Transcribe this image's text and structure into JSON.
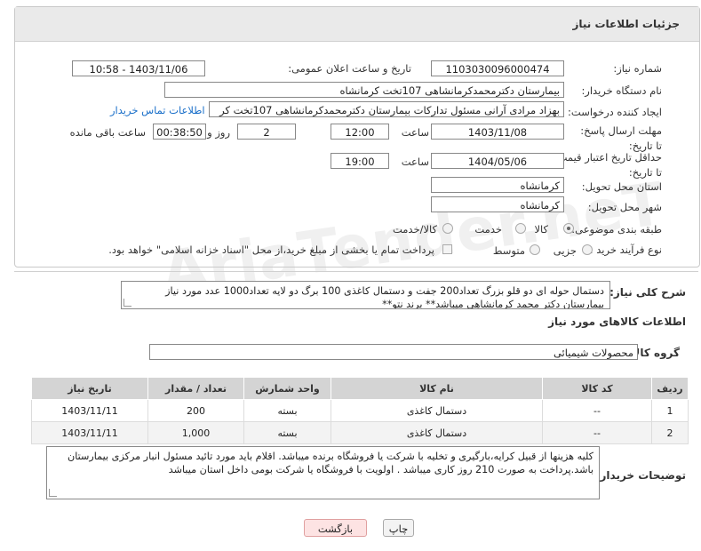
{
  "panel_title": "جزئیات اطلاعات نیاز",
  "fields": {
    "need_number_label": "شماره نیاز:",
    "need_number": "1103030096000474",
    "announce_label": "تاریخ و ساعت اعلان عمومی:",
    "announce_value": "1403/11/06 - 10:58",
    "buyer_org_label": "نام دستگاه خریدار:",
    "buyer_org": "بیمارستان دکترمحمدکرمانشاهی 107تخت کرمانشاه",
    "requester_label": "ایجاد کننده درخواست:",
    "requester": "بهزاد مرادی آرانی مسئول تدارکات بیمارستان دکترمحمدکرمانشاهی 107تخت کر",
    "contact_link": "اطلاعات تماس خریدار",
    "deadline_label": "مهلت ارسال پاسخ: تا تاریخ:",
    "deadline_date": "1403/11/08",
    "time_label": "ساعت",
    "deadline_time": "12:00",
    "days_value": "2",
    "days_label": "روز و",
    "remaining_value": "00:38:50",
    "remaining_label": "ساعت باقی مانده",
    "validity_label": "حداقل تاریخ اعتبار قیمت: تا تاریخ:",
    "validity_date": "1404/05/06",
    "validity_time": "19:00",
    "province_label": "استان محل تحویل:",
    "province": "کرمانشاه",
    "city_label": "شهر محل تحویل:",
    "city": "کرمانشاه",
    "category_label": "طبقه بندی موضوعی:",
    "category_options": [
      "کالا",
      "خدمت",
      "کالا/خدمت"
    ],
    "process_label": "نوع فرآیند خرید :",
    "process_options": [
      "جزیی",
      "متوسط"
    ],
    "payment_note": "پرداخت تمام یا بخشی از مبلغ خرید،از محل \"اسناد خزانه اسلامی\" خواهد بود."
  },
  "summary_label": "شرح کلی نیاز:",
  "summary_text": "دستمال حوله ای دو قلو بزرگ تعداد200 جفت و دستمال کاغذی 100 برگ دو لایه تعداد1000 عدد مورد نیاز بیمارستان دکتر محمد کرمانشاهی میباشد** برند نتو**",
  "goods_info_title": "اطلاعات کالاهای مورد نیاز",
  "goods_group_label": "گروه کالا:",
  "goods_group_value": "محصولات شیمیائی",
  "table": {
    "headers": [
      "ردیف",
      "کد کالا",
      "نام کالا",
      "واحد شمارش",
      "تعداد / مقدار",
      "تاریخ نیاز"
    ],
    "rows": [
      [
        "1",
        "--",
        "دستمال کاغذی",
        "بسته",
        "200",
        "1403/11/11"
      ],
      [
        "2",
        "--",
        "دستمال کاغذی",
        "بسته",
        "1,000",
        "1403/11/11"
      ]
    ]
  },
  "buyer_notes_label": "توضیحات خریدار:",
  "buyer_notes": "کلیه هزینها از قبیل کرایه،بارگیری و تخلیه با شرکت یا فروشگاه برنده میباشد. اقلام باید مورد تائید مسئول انبار مرکزی بیمارستان باشد.پرداخت به صورت 210 روز کاری میباشد . اولویت با فروشگاه یا شرکت بومی داخل استان میباشد",
  "buttons": {
    "print": "چاپ",
    "back": "بازگشت"
  },
  "watermark": "AriaTender.neT",
  "colors": {
    "link": "#1a6fc9",
    "back_button_bg": "#fde3e3",
    "print_button_bg": "#f3f3f3"
  }
}
